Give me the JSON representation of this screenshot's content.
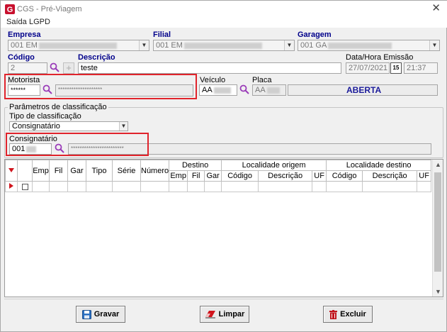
{
  "window": {
    "title": "CGS - Pré-Viagem",
    "close_glyph": "✕"
  },
  "menu": [
    {
      "label": "Saída"
    },
    {
      "label": "LGPD"
    }
  ],
  "empresa": {
    "label": "Empresa",
    "value": "001 EM"
  },
  "filial": {
    "label": "Filial",
    "value": "001 EM"
  },
  "garagem": {
    "label": "Garagem",
    "value": "001 GA"
  },
  "codigo": {
    "label": "Código",
    "value": "2"
  },
  "descricao": {
    "label": "Descrição",
    "value": "teste"
  },
  "data_hora": {
    "label": "Data/Hora Emissão",
    "date": "27/07/2021",
    "time": "21:37",
    "calendar_glyph": "15"
  },
  "motorista": {
    "label": "Motorista",
    "code": "******",
    "name": "********************"
  },
  "veiculo": {
    "label": "Veículo",
    "value": "AA"
  },
  "placa": {
    "label": "Placa",
    "value": "AA"
  },
  "status": "ABERTA",
  "parametros": {
    "title": "Parâmetros de classificação",
    "tipo_label": "Tipo de classificação",
    "tipo_value": "Consignatário",
    "consignatario_label": "Consignatário",
    "consignatario_code": "001",
    "consignatario_name": "************************"
  },
  "grid": {
    "columns": [
      "Emp",
      "Fil",
      "Gar",
      "Tipo",
      "Série",
      "Número"
    ],
    "group_destino": "Destino",
    "destino_cols": [
      "Emp",
      "Fil",
      "Gar"
    ],
    "group_origem": "Localidade origem",
    "origem_cols": [
      "Código",
      "Descrição",
      "UF"
    ],
    "group_dest_loc": "Localidade destino",
    "dest_loc_cols": [
      "Código",
      "Descrição",
      "UF"
    ]
  },
  "buttons": {
    "gravar": "Gravar",
    "limpar": "Limpar",
    "excluir": "Excluir"
  },
  "colors": {
    "label_blue": "#00008b",
    "highlight_red": "#e0242c",
    "status_blue": "#1a1a9a"
  }
}
